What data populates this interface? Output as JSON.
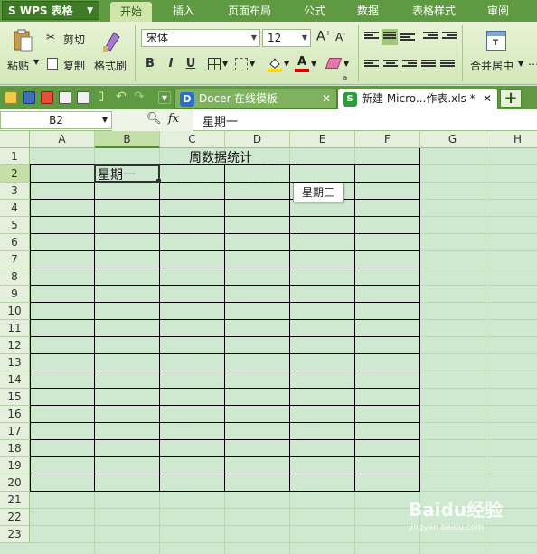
{
  "app": {
    "name": "WPS 表格",
    "menu_arrow": "▼"
  },
  "menu_tabs": [
    "开始",
    "插入",
    "页面布局",
    "公式",
    "数据",
    "表格样式",
    "审阅"
  ],
  "ribbon": {
    "paste": "粘贴",
    "cut": "剪切",
    "copy": "复制",
    "format_painter": "格式刷",
    "font_name": "宋体",
    "font_size": "12",
    "bold": "B",
    "italic": "I",
    "underline": "U",
    "merge_center": "合并居中"
  },
  "tabs": [
    {
      "label": "Docer-在线模板",
      "close": "✕"
    },
    {
      "label": "新建 Micro...作表.xls *",
      "close": "✕"
    }
  ],
  "add_tab": "+",
  "formula_bar": {
    "cell_ref": "B2",
    "fx": "fx",
    "content": "星期一"
  },
  "columns": [
    "A",
    "B",
    "C",
    "D",
    "E",
    "F",
    "G",
    "H"
  ],
  "rows": [
    "1",
    "2",
    "3",
    "4",
    "5",
    "6",
    "7",
    "8",
    "9",
    "10",
    "11",
    "12",
    "13",
    "14",
    "15",
    "16",
    "17",
    "18",
    "19",
    "20",
    "21",
    "22",
    "23"
  ],
  "sheet": {
    "title": "周数据统计",
    "b2": "星期一",
    "tooltip": "星期三"
  },
  "watermark": {
    "text": "Baidu经验",
    "sub": "jingyan.baidu.com"
  },
  "colors": {
    "accent": "#5f9a42",
    "grid_bg": "#cfe8d0"
  }
}
